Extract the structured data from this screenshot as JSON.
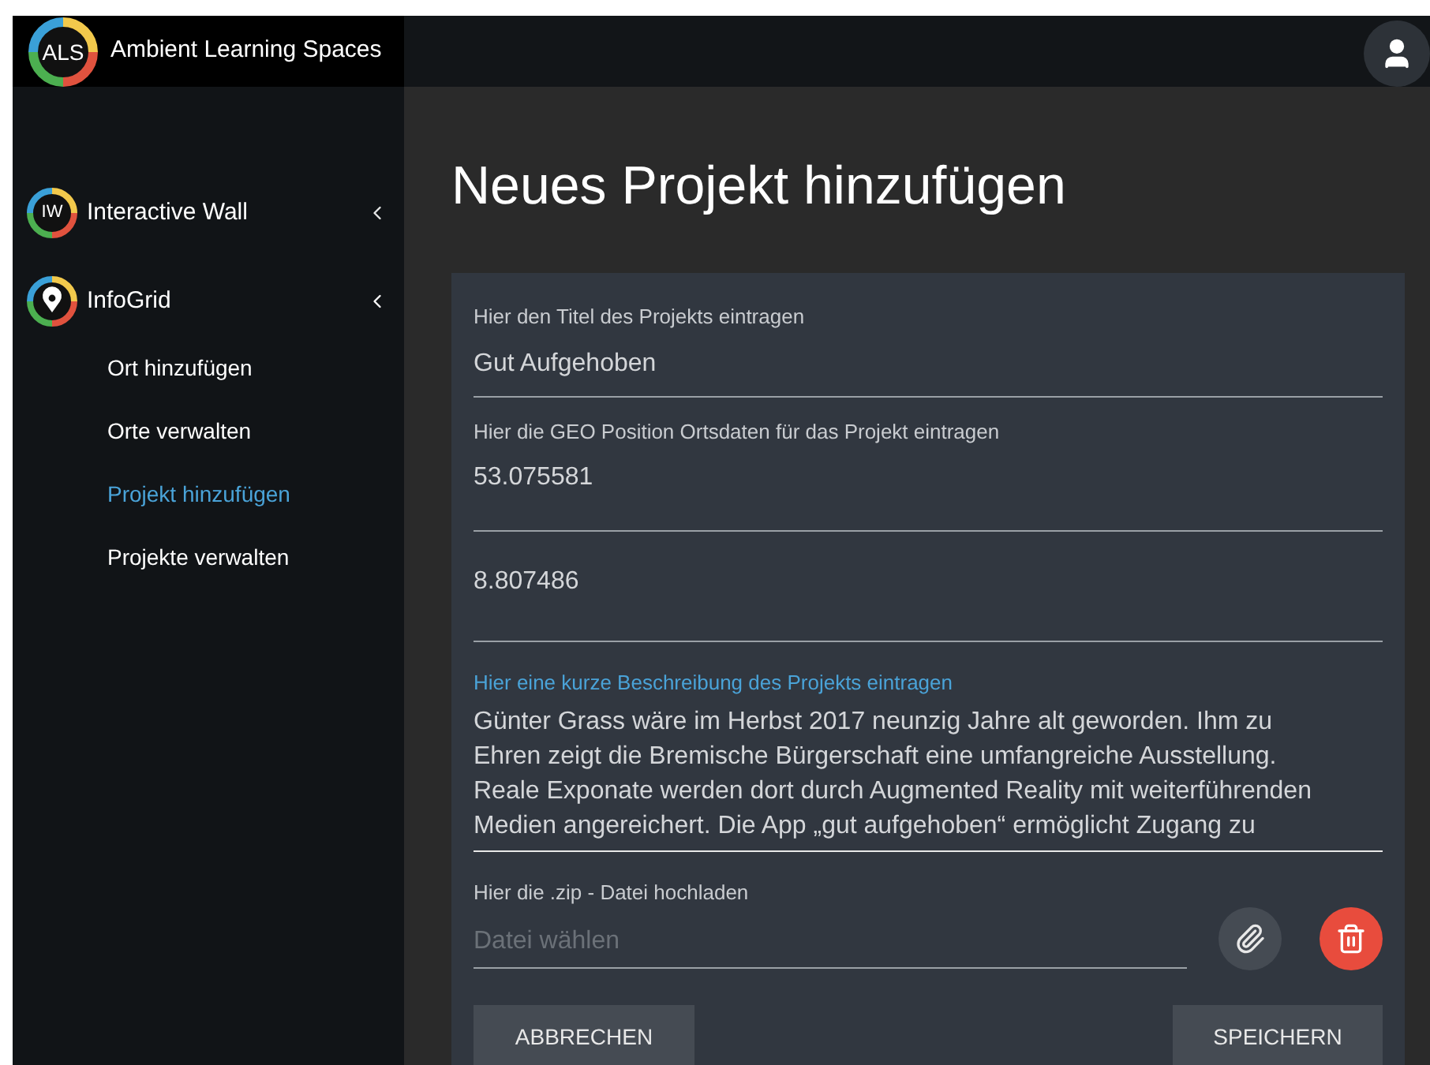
{
  "brand": {
    "logo": "ALS",
    "name": "Ambient Learning Spaces"
  },
  "sidebar": {
    "groups": [
      {
        "label": "Interactive Wall",
        "badge": "IW",
        "kind": "wall",
        "expanded": false
      },
      {
        "label": "InfoGrid",
        "kind": "pin",
        "expanded": true,
        "children": [
          {
            "label": "Ort hinzufügen",
            "selected": false
          },
          {
            "label": "Orte verwalten",
            "selected": false
          },
          {
            "label": "Projekt hinzufügen",
            "selected": true
          },
          {
            "label": "Projekte verwalten",
            "selected": false
          }
        ]
      }
    ]
  },
  "page_title": "Neues Projekt hinzufügen",
  "form": {
    "fields": [
      {
        "kind": "text",
        "label": "Hier den Titel des Projekts eintragen",
        "value": "Gut Aufgehoben",
        "focused": false
      },
      {
        "kind": "text",
        "label": "Hier die GEO Position Ortsdaten für das Projekt eintragen",
        "value": "53.075581",
        "focused": false
      },
      {
        "kind": "text",
        "value": "8.807486",
        "focused": false
      },
      {
        "kind": "textarea",
        "label": "Hier eine kurze Beschreibung des Projekts eintragen",
        "focused": true,
        "lines": [
          "Günter Grass wäre im Herbst 2017 neunzig Jahre alt geworden. Ihm zu",
          "Ehren zeigt die Bremische Bürgerschaft eine umfangreiche Ausstellung.",
          "Reale Exponate werden dort durch Augmented Reality mit weiterführenden",
          "Medien angereichert. Die App „gut aufgehoben“ ermöglicht Zugang zu"
        ]
      },
      {
        "kind": "file",
        "label": "Hier die .zip - Datei hochladen",
        "placeholder": "Datei wählen",
        "focused": false
      }
    ],
    "buttons": {
      "cancel": "ABBRECHEN",
      "save": "SPEICHERN"
    }
  }
}
